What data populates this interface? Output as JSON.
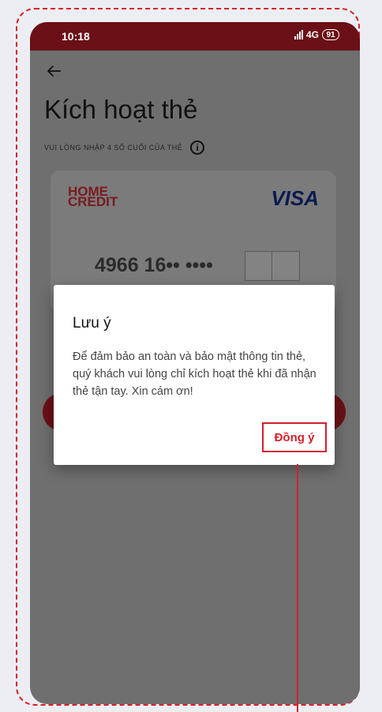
{
  "status_bar": {
    "time": "10:18",
    "network": "4G",
    "battery": "91"
  },
  "screen": {
    "title": "Kích hoạt thẻ",
    "subtitle": "VUI LÒNG NHẬP 4 SỐ CUỐI CỦA THẺ",
    "card": {
      "issuer_logo_line1": "HOME",
      "issuer_logo_line2": "CREDIT",
      "network_logo": "VISA",
      "masked_number": "4966 16•• ••••"
    }
  },
  "dialog": {
    "title": "Lưu ý",
    "message": "Để đảm bảo an toàn và bảo mật thông tin thẻ, quý khách vui lòng chỉ kích hoạt thẻ khi đã nhận thẻ tận tay. Xin cám ơn!",
    "confirm_label": "Đồng ý"
  },
  "colors": {
    "accent": "#d3202a",
    "brand_dark": "#6b1016",
    "visa_blue": "#0a1b50"
  },
  "icons": [
    "back-arrow-icon",
    "info-icon",
    "signal-icon",
    "battery-icon"
  ]
}
